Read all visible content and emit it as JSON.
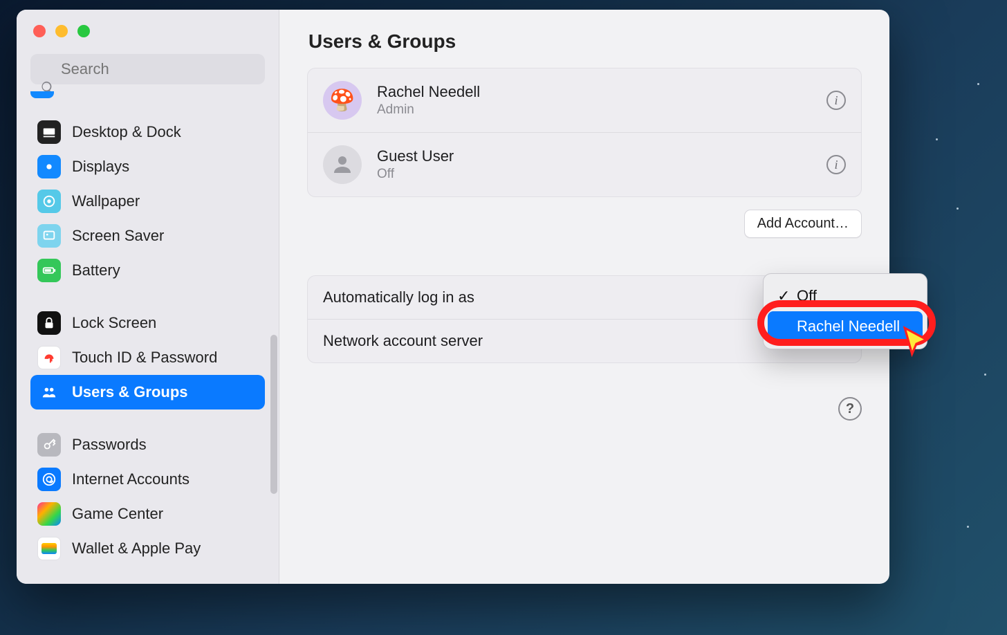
{
  "search": {
    "placeholder": "Search"
  },
  "sidebar": {
    "items": [
      {
        "label": "Desktop & Dock"
      },
      {
        "label": "Displays"
      },
      {
        "label": "Wallpaper"
      },
      {
        "label": "Screen Saver"
      },
      {
        "label": "Battery"
      },
      {
        "label": "Lock Screen"
      },
      {
        "label": "Touch ID & Password"
      },
      {
        "label": "Users & Groups"
      },
      {
        "label": "Passwords"
      },
      {
        "label": "Internet Accounts"
      },
      {
        "label": "Game Center"
      },
      {
        "label": "Wallet & Apple Pay"
      }
    ]
  },
  "main": {
    "title": "Users & Groups",
    "users": [
      {
        "name": "Rachel Needell",
        "role": "Admin"
      },
      {
        "name": "Guest User",
        "role": "Off"
      }
    ],
    "add_account": "Add Account…",
    "settings": {
      "auto_login": "Automatically log in as",
      "network_server": "Network account server"
    },
    "help": "?"
  },
  "popup": {
    "options": [
      {
        "label": "Off",
        "checked": true
      },
      {
        "label": "Rachel Needell",
        "checked": false,
        "selected": true
      }
    ]
  }
}
